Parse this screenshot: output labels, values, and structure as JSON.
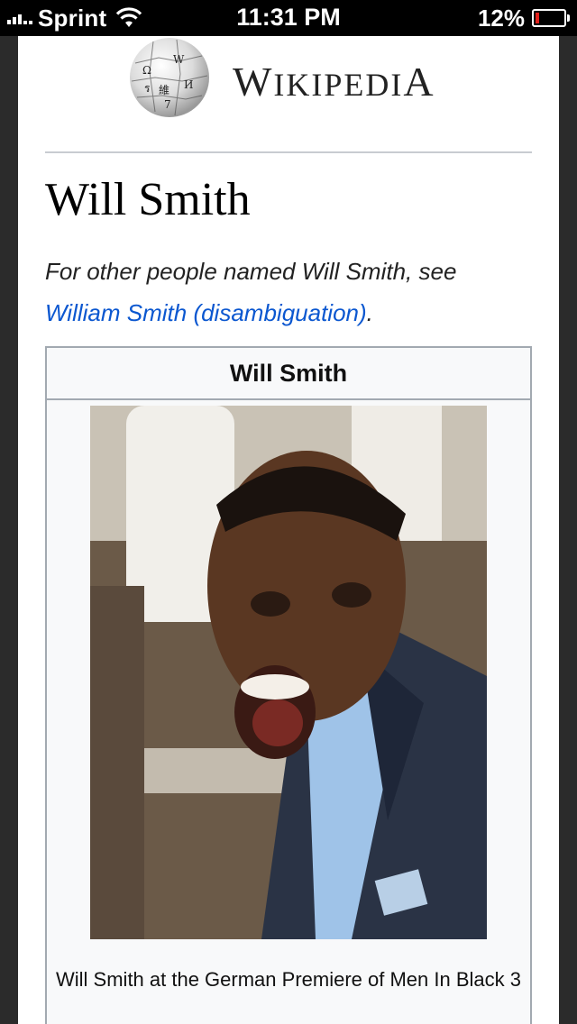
{
  "status_bar": {
    "carrier": "Sprint",
    "time": "11:31 PM",
    "battery": "12%",
    "battery_level": 0.12
  },
  "header": {
    "logo_alt": "Wikipedia globe logo",
    "wordmark_first": "W",
    "wordmark_rest": "IKIPEDI",
    "wordmark_last": "A"
  },
  "article": {
    "title": "Will Smith",
    "hatnote_prefix": "For other people named Will Smith, see ",
    "hatnote_link": "William Smith (disambiguation)",
    "hatnote_suffix": "."
  },
  "infobox": {
    "title": "Will Smith",
    "caption": "Will Smith at the German Premiere of Men In Black 3"
  },
  "colors": {
    "link": "#0b57d0",
    "battery_low": "#e0201b"
  },
  "icons": [
    "signal-bars-icon",
    "wifi-icon",
    "battery-icon",
    "wikipedia-globe-icon"
  ]
}
